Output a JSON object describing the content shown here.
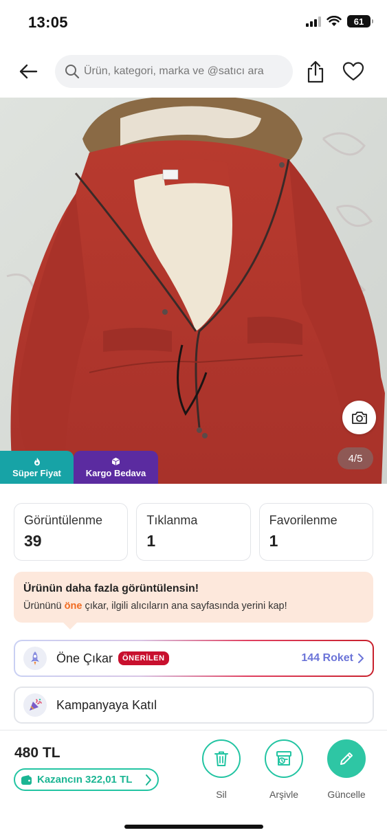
{
  "status_bar": {
    "time": "13:05",
    "battery": "61"
  },
  "search": {
    "placeholder": "Ürün, kategori, marka ve @satıcı ara"
  },
  "photo": {
    "page_counter": "4/5",
    "badges": [
      {
        "label": "Süper Fiyat",
        "icon": "flame-icon",
        "color": "#17a3a6"
      },
      {
        "label": "Kargo Bedava",
        "icon": "box-icon",
        "color": "#5b2ba0"
      }
    ]
  },
  "stats": [
    {
      "label": "Görüntülenme",
      "value": "39"
    },
    {
      "label": "Tıklanma",
      "value": "1"
    },
    {
      "label": "Favorilenme",
      "value": "1"
    }
  ],
  "promo": {
    "title": "Ürünün daha fazla görüntülensin!",
    "text_before": "Ürününü ",
    "highlight": "öne",
    "text_after": " çıkar, ilgili alıcıların ana sayfasında yerini kap!"
  },
  "featured_row": {
    "label": "Öne Çıkar",
    "badge": "ÖNERİLEN",
    "cost": "144 Roket",
    "icon": "rocket-icon"
  },
  "campaign_row": {
    "label": "Kampanyaya Katıl",
    "icon": "party-icon"
  },
  "bottom": {
    "price": "480 TL",
    "earnings": "Kazancın 322,01 TL",
    "actions": [
      {
        "label": "Sil",
        "icon": "trash-icon"
      },
      {
        "label": "Arşivle",
        "icon": "archive-icon"
      },
      {
        "label": "Güncelle",
        "icon": "pencil-icon"
      }
    ]
  },
  "colors": {
    "accent": "#22c4a2",
    "recommended": "#c8102e",
    "roket": "#6b74d8",
    "promo_bg": "#fde8dc"
  }
}
